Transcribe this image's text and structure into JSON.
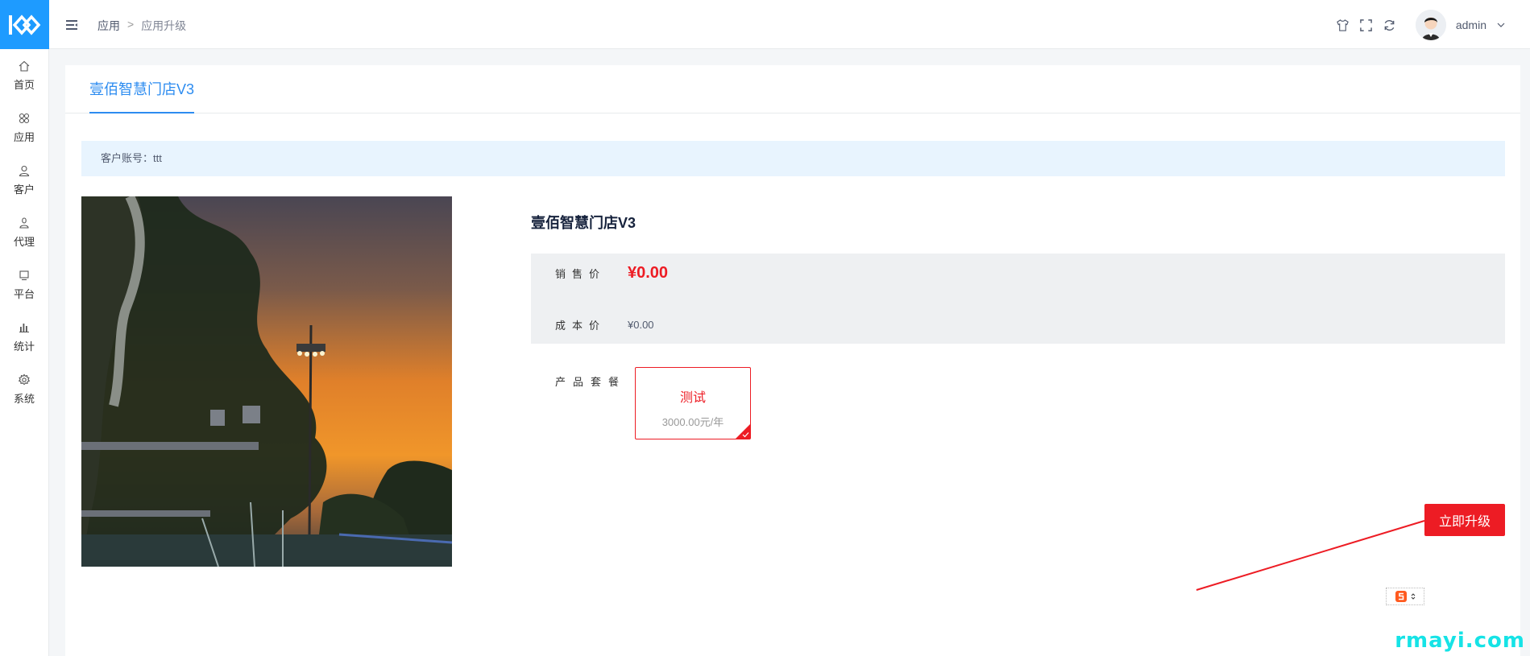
{
  "sidebar": {
    "items": [
      {
        "label": "首页",
        "icon": "home-icon"
      },
      {
        "label": "应用",
        "icon": "apps-icon"
      },
      {
        "label": "客户",
        "icon": "user-icon"
      },
      {
        "label": "代理",
        "icon": "agent-icon"
      },
      {
        "label": "平台",
        "icon": "platform-icon"
      },
      {
        "label": "统计",
        "icon": "chart-icon"
      },
      {
        "label": "系统",
        "icon": "gear-icon"
      }
    ]
  },
  "header": {
    "breadcrumb": [
      "应用",
      "应用升级"
    ],
    "breadcrumb_sep": ">",
    "username": "admin"
  },
  "tabs": {
    "active": "壹佰智慧门店V3"
  },
  "account": {
    "label": "客户账号：ttt"
  },
  "product": {
    "title": "壹佰智慧门店V3",
    "sale_price_label": "销售价",
    "sale_price": "¥0.00",
    "cost_price_label": "成本价",
    "cost_price": "¥0.00",
    "package_label": "产品套餐",
    "package": {
      "name": "测试",
      "price": "3000.00元/年"
    }
  },
  "actions": {
    "upgrade_label": "立即升级"
  },
  "watermark": "rmayi.com",
  "colors": {
    "brand": "#1e9bff",
    "accent": "#2d8cf0",
    "danger": "#ed1c24"
  }
}
